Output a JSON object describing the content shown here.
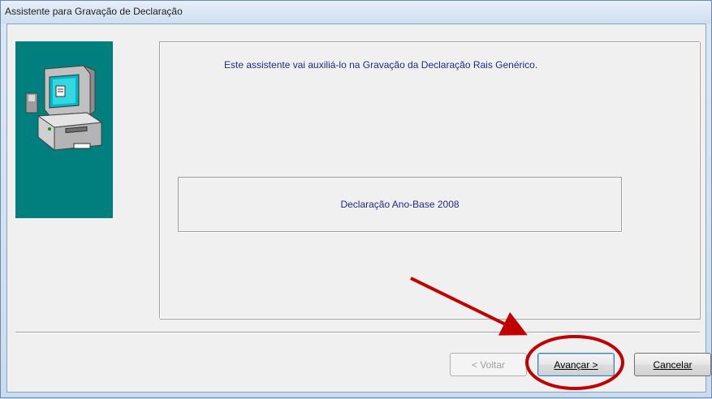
{
  "window": {
    "title": "Assistente para Gravação de Declaração"
  },
  "wizard": {
    "intro_text": "Este assistente vai auxiliá-lo na Gravação da Declaração Rais Genérico.",
    "declaration_label": "Declaração Ano-Base 2008",
    "illustration_icon": "computer-icon"
  },
  "buttons": {
    "back_label": "< Voltar",
    "back_enabled": false,
    "next_label": "Avançar >",
    "cancel_label": "Cancelar"
  },
  "annotations": {
    "highlight_target": "next-button",
    "arrow_color": "#c00000",
    "circle_color": "#c00000"
  },
  "colors": {
    "illustration_background": "#007f7f",
    "text_color": "#1f2a8a",
    "dialog_background": "#f0f0f0"
  }
}
